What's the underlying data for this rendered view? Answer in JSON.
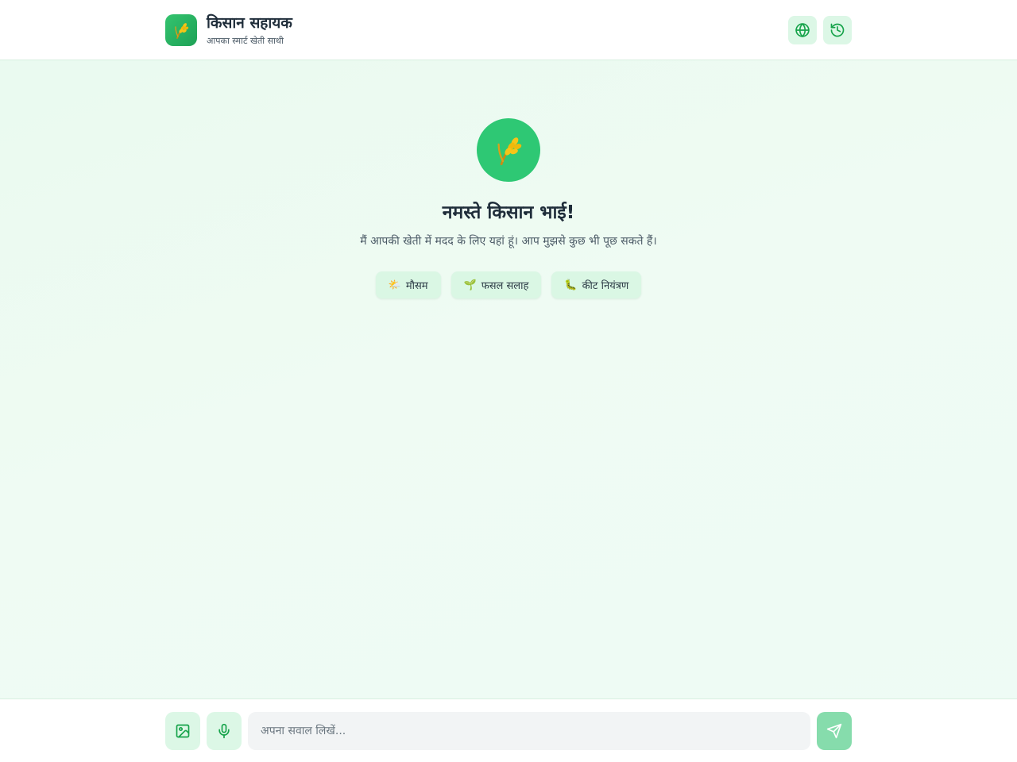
{
  "header": {
    "app_title": "किसान सहायक",
    "app_subtitle": "आपका स्मार्ट खेती साथी",
    "logo_icon": "rice-sheaf-icon",
    "buttons": [
      {
        "icon": "globe-icon"
      },
      {
        "icon": "history-icon"
      }
    ]
  },
  "welcome": {
    "avatar_icon": "rice-sheaf-icon",
    "title": "नमस्ते किसान भाई!",
    "subtitle": "मैं आपकी खेती में मदद के लिए यहां हूं। आप मुझसे कुछ भी पूछ सकते हैं।",
    "chips": [
      {
        "emoji": "🌤️",
        "label": "मौसम"
      },
      {
        "emoji": "🌱",
        "label": "फसल सलाह"
      },
      {
        "emoji": "🐛",
        "label": "कीट नियंत्रण"
      }
    ]
  },
  "composer": {
    "placeholder": "अपना सवाल लिखें...",
    "value": "",
    "buttons": [
      {
        "icon": "image-icon"
      },
      {
        "icon": "microphone-icon"
      },
      {
        "icon": "send-icon"
      }
    ]
  },
  "colors": {
    "accent": "#16a34a",
    "accent_light": "#dcf7e6",
    "send_disabled": "#86dcac",
    "avatar_bg": "#2ec874"
  }
}
